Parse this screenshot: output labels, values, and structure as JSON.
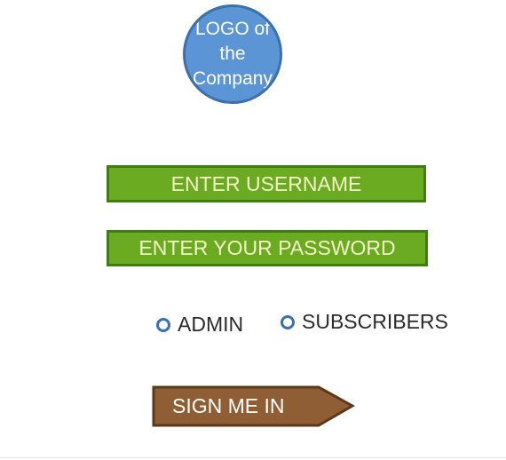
{
  "logo": {
    "text": "LOGO of\nthe\nCompany"
  },
  "form": {
    "username_label": "ENTER USERNAME",
    "password_label": "ENTER YOUR PASSWORD"
  },
  "role_options": [
    {
      "label": "ADMIN"
    },
    {
      "label": "SUBSCRIBERS"
    }
  ],
  "signin": {
    "label": "SIGN ME IN"
  },
  "colors": {
    "logo_fill": "#5b95d6",
    "field_fill": "#6aab22",
    "field_border": "#3f7d12",
    "signin_fill": "#8f5e34",
    "radio_ring": "#3a6fb0"
  }
}
